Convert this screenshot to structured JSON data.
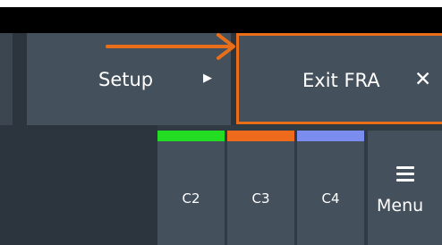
{
  "toolbar": {
    "setup_label": "Setup",
    "exit_label": "Exit FRA",
    "close_glyph": "✕",
    "submenu_glyph": "▶"
  },
  "channels": [
    {
      "label": "C2",
      "color": "#22dd22"
    },
    {
      "label": "C3",
      "color": "#ee6a1c"
    },
    {
      "label": "C4",
      "color": "#7b8ef0"
    }
  ],
  "menu": {
    "label": "Menu",
    "icon": "hamburger-icon"
  },
  "colors": {
    "highlight": "#e86e1a",
    "button_bg": "#44505b",
    "panel_bg": "#2c353e"
  }
}
